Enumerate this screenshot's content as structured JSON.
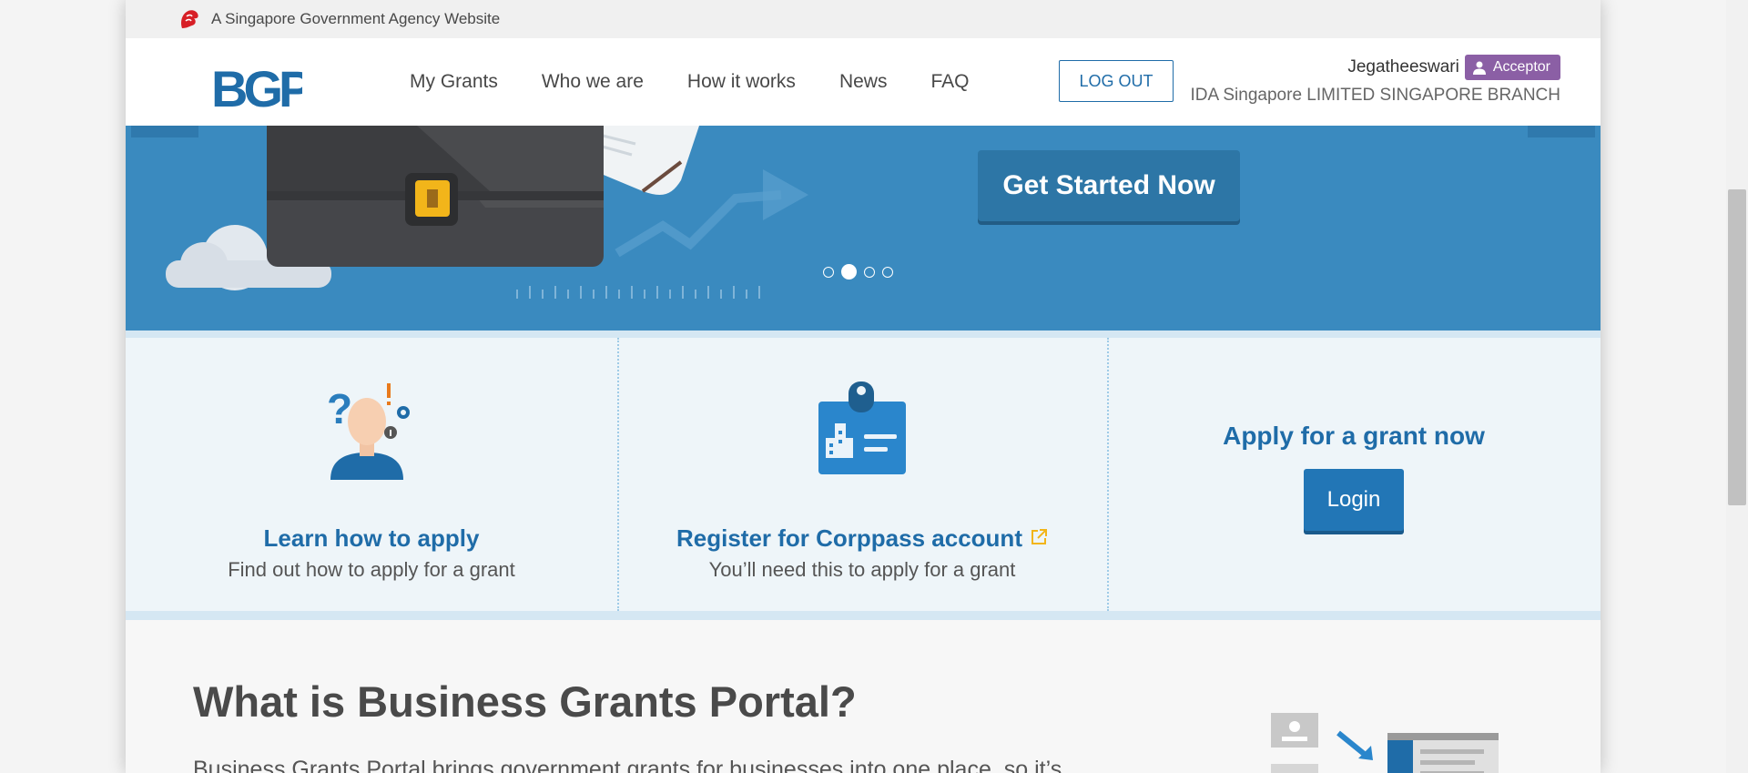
{
  "gov_bar": {
    "text": "A Singapore Government Agency Website"
  },
  "header": {
    "logo": "BGP",
    "nav": [
      "My Grants",
      "Who we are",
      "How it works",
      "News",
      "FAQ"
    ],
    "logout_label": "LOG OUT",
    "user": {
      "name": "Jegatheeswari",
      "role": "Acceptor",
      "company": "IDA Singapore LIMITED SINGAPORE BRANCH"
    }
  },
  "banner": {
    "cta_label": "Get Started Now",
    "carousel": {
      "slides": 4,
      "active": 2
    }
  },
  "cards": {
    "learn": {
      "title": "Learn how to apply",
      "subtitle": "Find out how to apply for a grant"
    },
    "register": {
      "title": "Register for Corppass account",
      "subtitle": "You’ll need this to apply for a grant"
    },
    "apply": {
      "title": "Apply for a grant now",
      "login_label": "Login"
    }
  },
  "about": {
    "heading": "What is Business Grants Portal?",
    "text": "Business Grants Portal brings government grants for businesses into one place, so it’s"
  },
  "colors": {
    "primary": "#1f6ca8",
    "banner": "#3a8abf",
    "badge": "#8b5fa5",
    "cta": "#2d76a6"
  }
}
